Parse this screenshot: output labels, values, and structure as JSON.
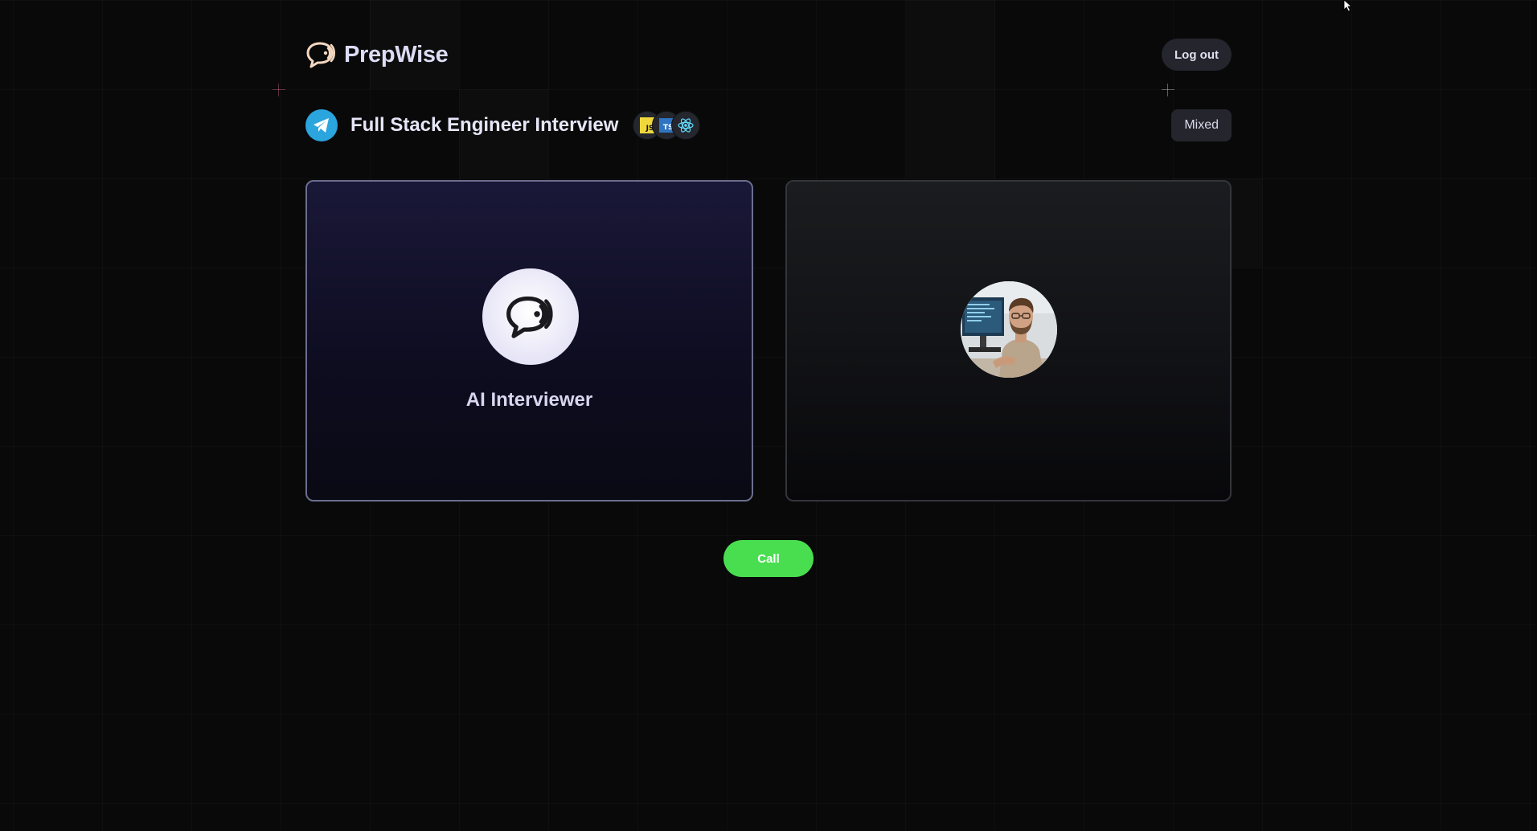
{
  "header": {
    "brand_name": "PrepWise",
    "logout_label": "Log out"
  },
  "interview": {
    "title": "Full Stack Engineer Interview",
    "type": "Mixed",
    "tech_stack": [
      {
        "name": "JavaScript",
        "label": "JS"
      },
      {
        "name": "TypeScript",
        "label": "TS"
      },
      {
        "name": "React",
        "label": ""
      }
    ]
  },
  "cards": {
    "ai_label": "AI Interviewer"
  },
  "actions": {
    "call_label": "Call"
  },
  "colors": {
    "accent_call": "#49de50",
    "ai_card_border": "#6b6e8e",
    "company_logo": "#2aa5de",
    "background": "#09090a"
  }
}
